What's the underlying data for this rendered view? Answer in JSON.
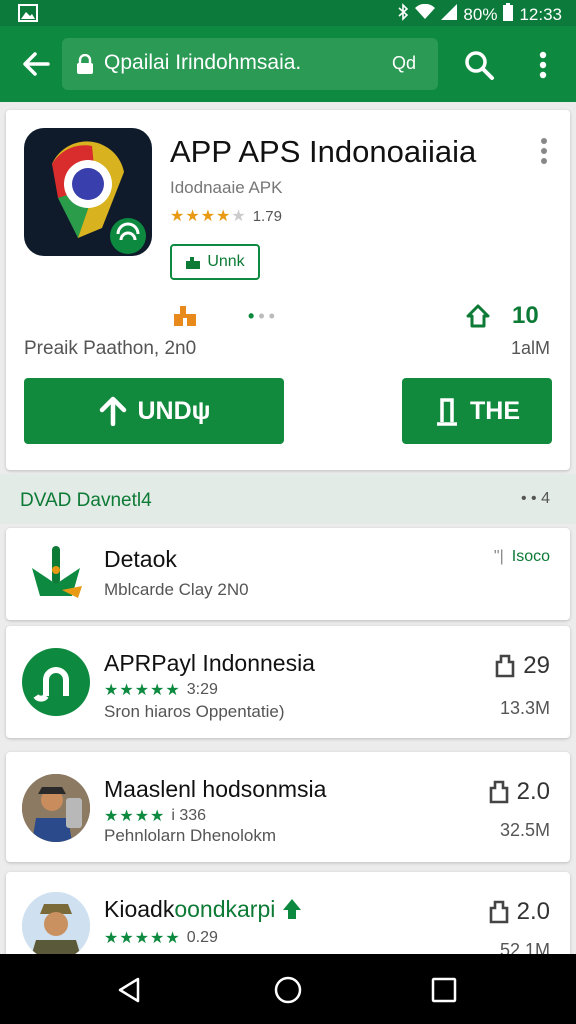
{
  "status": {
    "battery": "80%",
    "time": "12:33"
  },
  "appbar": {
    "query": "Qpailai Irindohmsaia.",
    "query_suffix": "Qd"
  },
  "app": {
    "title": "APP APS Indonoaiiaia",
    "developer": "Idodnaaie APK",
    "rating": "1.79",
    "badge_label": "Unnk",
    "meta_left": "Preaik Paathon, 2n0",
    "size_top": "10",
    "size_bottom": "1alM",
    "install_label": "UNDψ",
    "open_label": "THE"
  },
  "section": {
    "title": "DVAD Davnetl4",
    "more": "• • 4"
  },
  "items": [
    {
      "name": "Detaok",
      "sub": "Mblcarde Clay 2N0",
      "right": "Isoco"
    },
    {
      "name": "APRPayl Indonnesia",
      "rating": "3:29",
      "sub": "Sron hiaros Oppentatie)",
      "top": "29",
      "bottom": "13.3M"
    },
    {
      "name": "Maaslenl hodsonmsia",
      "rating": "i 336",
      "sub": "Pehnlolarn Dhenolokm",
      "top": "2.0",
      "bottom": "32.5M"
    },
    {
      "name": "Kioadk",
      "name_accent": "oondkarpi",
      "rating": "0.29",
      "sub": "",
      "top": "2.0",
      "bottom": "52.1M"
    }
  ],
  "colors": {
    "primary": "#0d8a3f",
    "star_gold": "#e89a14"
  }
}
